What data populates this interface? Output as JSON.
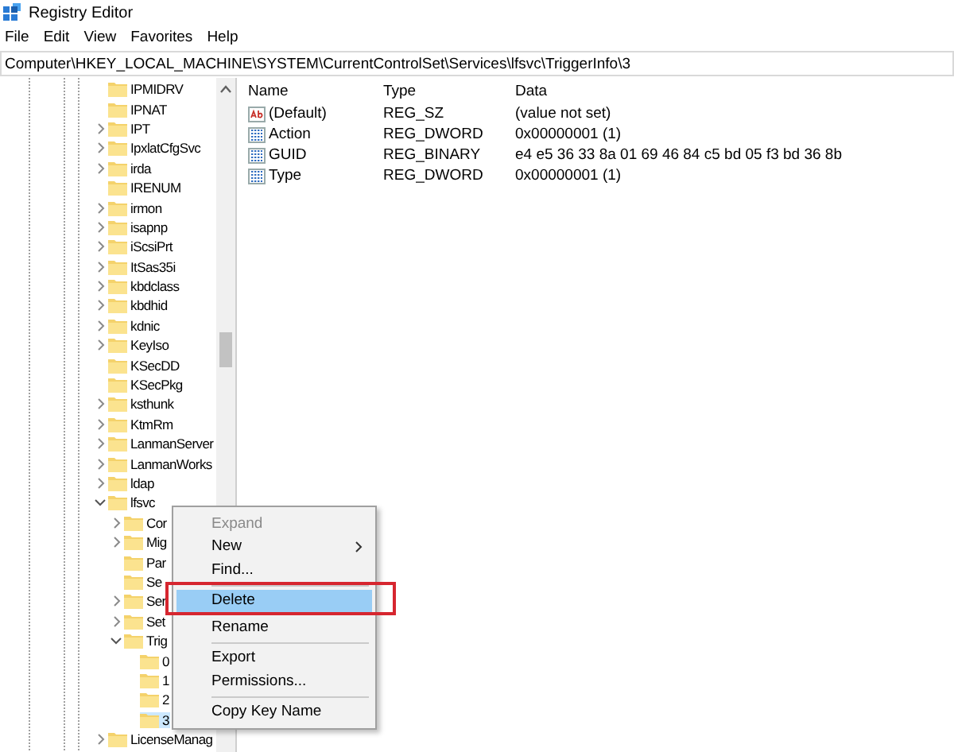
{
  "window": {
    "title": "Registry Editor"
  },
  "menu_bar": [
    {
      "label": "File"
    },
    {
      "label": "Edit"
    },
    {
      "label": "View"
    },
    {
      "label": "Favorites"
    },
    {
      "label": "Help"
    }
  ],
  "address_bar": {
    "value": "Computer\\HKEY_LOCAL_MACHINE\\SYSTEM\\CurrentControlSet\\Services\\lfsvc\\TriggerInfo\\3"
  },
  "tree": [
    {
      "label": "IPMIDRV",
      "expandable": false,
      "selected": false
    },
    {
      "label": "IPNAT",
      "expandable": false,
      "selected": false
    },
    {
      "label": "IPT",
      "expandable": true,
      "expanded": false,
      "selected": false
    },
    {
      "label": "IpxlatCfgSvc",
      "expandable": true,
      "expanded": false,
      "selected": false
    },
    {
      "label": "irda",
      "expandable": true,
      "expanded": false,
      "selected": false
    },
    {
      "label": "IRENUM",
      "expandable": false,
      "selected": false
    },
    {
      "label": "irmon",
      "expandable": true,
      "expanded": false,
      "selected": false
    },
    {
      "label": "isapnp",
      "expandable": true,
      "expanded": false,
      "selected": false
    },
    {
      "label": "iScsiPrt",
      "expandable": true,
      "expanded": false,
      "selected": false
    },
    {
      "label": "ItSas35i",
      "expandable": true,
      "expanded": false,
      "selected": false
    },
    {
      "label": "kbdclass",
      "expandable": true,
      "expanded": false,
      "selected": false
    },
    {
      "label": "kbdhid",
      "expandable": true,
      "expanded": false,
      "selected": false
    },
    {
      "label": "kdnic",
      "expandable": true,
      "expanded": false,
      "selected": false
    },
    {
      "label": "KeyIso",
      "expandable": true,
      "expanded": false,
      "selected": false
    },
    {
      "label": "KSecDD",
      "expandable": false,
      "selected": false
    },
    {
      "label": "KSecPkg",
      "expandable": false,
      "selected": false
    },
    {
      "label": "ksthunk",
      "expandable": true,
      "expanded": false,
      "selected": false
    },
    {
      "label": "KtmRm",
      "expandable": true,
      "expanded": false,
      "selected": false
    },
    {
      "label": "LanmanServer",
      "expandable": true,
      "expanded": false,
      "selected": false
    },
    {
      "label": "LanmanWorks",
      "expandable": true,
      "expanded": false,
      "selected": false
    },
    {
      "label": "ldap",
      "expandable": true,
      "expanded": false,
      "selected": false
    },
    {
      "label": "lfsvc",
      "expandable": true,
      "expanded": true,
      "selected": false,
      "children": [
        {
          "label": "Cor",
          "expandable": true,
          "expanded": false,
          "selected": false
        },
        {
          "label": "Mig",
          "expandable": true,
          "expanded": false,
          "selected": false
        },
        {
          "label": "Par",
          "expandable": false,
          "selected": false
        },
        {
          "label": "Se",
          "expandable": false,
          "selected": false
        },
        {
          "label": "Ser",
          "expandable": true,
          "expanded": false,
          "selected": false
        },
        {
          "label": "Set",
          "expandable": true,
          "expanded": false,
          "selected": false
        },
        {
          "label": "Trig",
          "expandable": true,
          "expanded": true,
          "selected": false,
          "children": [
            {
              "label": "0",
              "expandable": false,
              "selected": false
            },
            {
              "label": "1",
              "expandable": false,
              "selected": false
            },
            {
              "label": "2",
              "expandable": false,
              "selected": false
            },
            {
              "label": "3",
              "expandable": false,
              "selected": true
            }
          ]
        }
      ]
    },
    {
      "label": "LicenseManag",
      "expandable": true,
      "expanded": false,
      "selected": false
    }
  ],
  "values_table": {
    "columns": [
      "Name",
      "Type",
      "Data"
    ],
    "rows": [
      {
        "kind": "string",
        "name": "(Default)",
        "type": "REG_SZ",
        "data": "(value not set)"
      },
      {
        "kind": "binary",
        "name": "Action",
        "type": "REG_DWORD",
        "data": "0x00000001 (1)"
      },
      {
        "kind": "binary",
        "name": "GUID",
        "type": "REG_BINARY",
        "data": "e4 e5 36 33 8a 01 69 46 84 c5 bd 05 f3 bd 36 8b"
      },
      {
        "kind": "binary",
        "name": "Type",
        "type": "REG_DWORD",
        "data": "0x00000001 (1)"
      }
    ]
  },
  "context_menu": {
    "items": [
      {
        "kind": "item",
        "label": "Expand",
        "disabled": true,
        "selected": false,
        "submenu": false,
        "framed": false
      },
      {
        "kind": "item",
        "label": "New",
        "disabled": false,
        "selected": false,
        "submenu": true,
        "framed": false
      },
      {
        "kind": "item",
        "label": "Find...",
        "disabled": false,
        "selected": false,
        "submenu": false,
        "framed": false
      },
      {
        "kind": "separator"
      },
      {
        "kind": "item",
        "label": "Delete",
        "disabled": false,
        "selected": true,
        "submenu": false,
        "framed": true
      },
      {
        "kind": "item",
        "label": "Rename",
        "disabled": false,
        "selected": false,
        "submenu": false,
        "framed": false
      },
      {
        "kind": "separator"
      },
      {
        "kind": "item",
        "label": "Export",
        "disabled": false,
        "selected": false,
        "submenu": false,
        "framed": false
      },
      {
        "kind": "item",
        "label": "Permissions...",
        "disabled": false,
        "selected": false,
        "submenu": false,
        "framed": false
      },
      {
        "kind": "separator"
      },
      {
        "kind": "item",
        "label": "Copy Key Name",
        "disabled": false,
        "selected": false,
        "submenu": false,
        "framed": false
      }
    ]
  }
}
